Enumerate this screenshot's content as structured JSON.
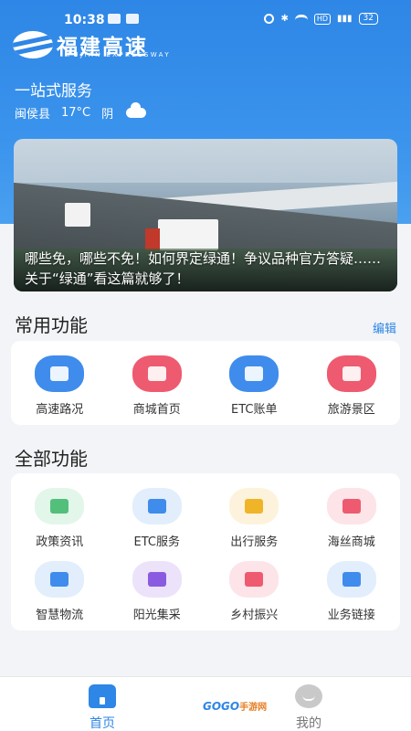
{
  "status_bar": {
    "time": "10:38",
    "battery": "32"
  },
  "logo": {
    "cn": "福建高速",
    "en": "FUJIAN EXPRESSWAY"
  },
  "slogan": "一站式服务",
  "weather": {
    "location": "闽侯县",
    "temperature": "17°C",
    "condition": "阴"
  },
  "banner": {
    "text": "哪些免，哪些不免！如何界定绿通！争议品种官方答疑……关于“绿通”看这篇就够了！"
  },
  "common": {
    "title": "常用功能",
    "edit_label": "编辑",
    "items": [
      {
        "label": "高速路况",
        "icon": "road-condition-icon",
        "color": "#3f8cec"
      },
      {
        "label": "商城首页",
        "icon": "shop-home-icon",
        "color": "#ee5a6f"
      },
      {
        "label": "ETC账单",
        "icon": "etc-bill-icon",
        "color": "#3f8cec"
      },
      {
        "label": "旅游景区",
        "icon": "scenic-spot-icon",
        "color": "#ee5a6f"
      }
    ]
  },
  "all": {
    "title": "全部功能",
    "items": [
      {
        "label": "政策资讯",
        "icon": "policy-news-icon",
        "color": "#52c07a",
        "bg": "#e3f6ea"
      },
      {
        "label": "ETC服务",
        "icon": "etc-service-icon",
        "color": "#3f8cec",
        "bg": "#e2eefc"
      },
      {
        "label": "出行服务",
        "icon": "travel-service-icon",
        "color": "#f0b429",
        "bg": "#fdf3dc"
      },
      {
        "label": "海丝商城",
        "icon": "haisi-mall-icon",
        "color": "#ee5a6f",
        "bg": "#fde4e8"
      },
      {
        "label": "智慧物流",
        "icon": "smart-logistics-icon",
        "color": "#3f8cec",
        "bg": "#e2eefc"
      },
      {
        "label": "阳光集采",
        "icon": "sunshine-purchase-icon",
        "color": "#8a5be0",
        "bg": "#ece3fb"
      },
      {
        "label": "乡村振兴",
        "icon": "rural-revitalization-icon",
        "color": "#ee5a6f",
        "bg": "#fde4e8"
      },
      {
        "label": "业务链接",
        "icon": "business-link-icon",
        "color": "#3f8cec",
        "bg": "#e2eefc"
      }
    ]
  },
  "tabs": {
    "home": "首页",
    "mine": "我的"
  },
  "watermark": {
    "brand": "GOGO",
    "suffix": "手游网"
  },
  "colors": {
    "primary": "#2e86e6",
    "background": "#f2f4f7"
  }
}
